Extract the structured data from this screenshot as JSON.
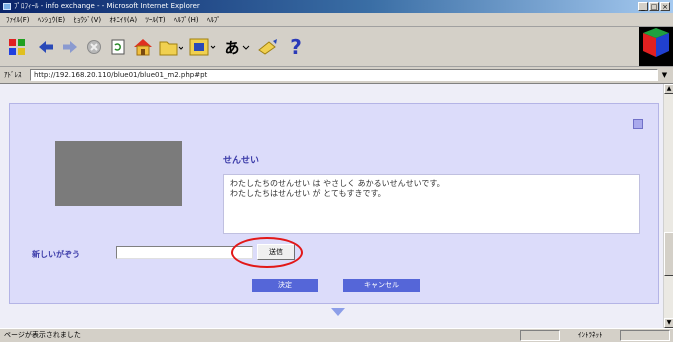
{
  "window": {
    "title": "ﾌﾟﾛﾌｨｰﾙ - info exchange - - Microsoft Internet Explorer",
    "buttons": {
      "minimize": "_",
      "maximize": "□",
      "close": "×"
    }
  },
  "menu": {
    "items": [
      "ﾌｧｲﾙ(F)",
      "ﾍﾝｼｭｳ(E)",
      "ﾋｮｳｼﾞ(V)",
      "ｵｷﾆｲﾘ(A)",
      "ﾂｰﾙ(T)",
      "ﾍﾙﾌﾟ(H)",
      "ﾍﾙﾌﾟ"
    ]
  },
  "toolbar": {
    "icons": [
      "Windows logo",
      "back",
      "forward",
      "stop",
      "refresh",
      "home",
      "favorites",
      "media",
      "font size",
      "mail",
      "help"
    ],
    "font_glyph": "あ",
    "help_glyph": "?"
  },
  "address": {
    "label": "ｱﾄﾞﾚｽ",
    "url": "http://192.168.20.110/blue01/blue01_m2.php#pt",
    "drop_glyph": "▼"
  },
  "profile": {
    "name": "せんせい",
    "description_lines": [
      "わたしたちのせんせい は  やさしく  あかるいせんせいです。",
      "わたしたちはせんせい が  とてもすきです。"
    ],
    "answer_label": "新しいがぞう",
    "answer_value": "",
    "send_label": "送信",
    "ok_label": "決定",
    "cancel_label": "キャンセル"
  },
  "status": {
    "text": "ページが表示されました",
    "zone": "ｲﾝﾄﾗﾈｯﾄ"
  },
  "colors": {
    "panel": "#dcdcfa",
    "accent": "#3a3aa8",
    "button": "#5566d8",
    "highlight": "#e21818"
  }
}
